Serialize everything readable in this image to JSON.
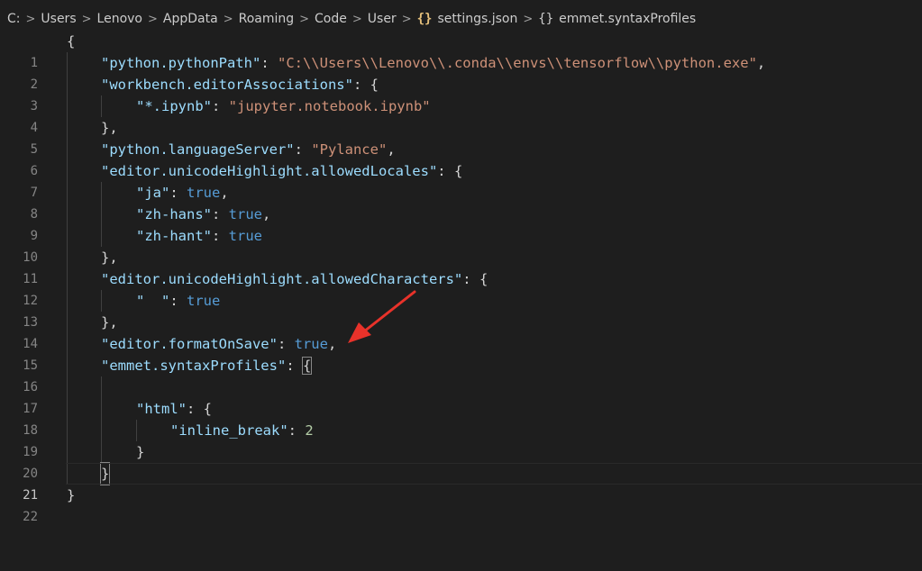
{
  "breadcrumb": {
    "drive": "C:",
    "parts": [
      "Users",
      "Lenovo",
      "AppData",
      "Roaming",
      "Code",
      "User"
    ],
    "file_icon": "{}",
    "file": "settings.json",
    "symbol_icon": "{}",
    "symbol": "emmet.syntaxProfiles"
  },
  "editor": {
    "active_line": "21",
    "lines": [
      {
        "n": "1",
        "text": "{"
      },
      {
        "n": "2",
        "k": "\"python.pythonPath\"",
        "s": "\"C:\\\\Users\\\\Lenovo\\\\.conda\\\\envs\\\\tensorflow\\\\python.exe\""
      },
      {
        "n": "3",
        "k": "\"workbench.editorAssociations\""
      },
      {
        "n": "4",
        "k": "\"*.ipynb\"",
        "s": "\"jupyter.notebook.ipynb\""
      },
      {
        "n": "5",
        "text": "},"
      },
      {
        "n": "6",
        "k": "\"python.languageServer\"",
        "s": "\"Pylance\""
      },
      {
        "n": "7",
        "k": "\"editor.unicodeHighlight.allowedLocales\""
      },
      {
        "n": "8",
        "k": "\"ja\"",
        "v": "true"
      },
      {
        "n": "9",
        "k": "\"zh-hans\"",
        "v": "true"
      },
      {
        "n": "10",
        "k": "\"zh-hant\"",
        "v": "true"
      },
      {
        "n": "11",
        "text": "},"
      },
      {
        "n": "12",
        "k": "\"editor.unicodeHighlight.allowedCharacters\""
      },
      {
        "n": "13",
        "k": "\"  \"",
        "v": "true"
      },
      {
        "n": "14",
        "text": "},"
      },
      {
        "n": "15",
        "k": "\"editor.formatOnSave\"",
        "v": "true"
      },
      {
        "n": "16",
        "k": "\"emmet.syntaxProfiles\""
      },
      {
        "n": "17",
        "text": ""
      },
      {
        "n": "18",
        "k": "\"html\""
      },
      {
        "n": "19",
        "k": "\"inline_break\"",
        "num": "2"
      },
      {
        "n": "20",
        "text": "}"
      },
      {
        "n": "21",
        "text": "}"
      },
      {
        "n": "22",
        "text": "}"
      }
    ]
  },
  "annotation": {
    "icon": "red-arrow-icon",
    "color": "#e8322a"
  }
}
